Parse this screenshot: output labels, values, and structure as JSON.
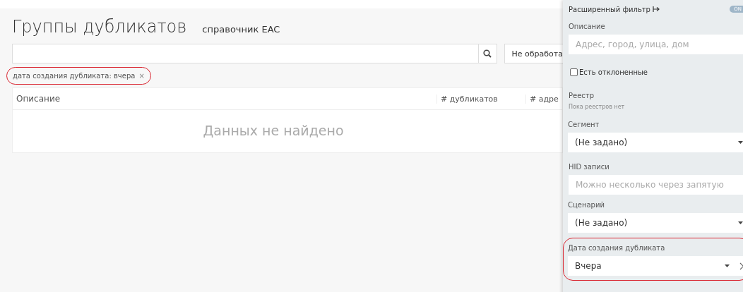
{
  "header": {
    "title": "Группы дубликатов",
    "subtitle": "справочник EAC"
  },
  "status_filter": {
    "value": "Не обработа"
  },
  "active_filters": [
    {
      "label": "дата создания дубликата: вчера",
      "close": "×",
      "highlighted": true
    }
  ],
  "table": {
    "columns": [
      "Описание",
      "# дубликатов",
      "# адре"
    ],
    "empty_message": "Данных не найдено"
  },
  "filter_panel": {
    "title": "Расширенный фильтр",
    "toggle": {
      "label": "ON",
      "on": true
    },
    "fields": [
      {
        "kind": "input",
        "label": "Описание",
        "placeholder": "Адрес, город, улица, дом"
      },
      {
        "kind": "checkbox",
        "label": "Есть отклоненные",
        "checked": false
      },
      {
        "kind": "note",
        "label": "Реестр",
        "note": "Пока реестров нет"
      },
      {
        "kind": "select",
        "label": "Сегмент",
        "value": "(Не задано)",
        "clearable": false
      },
      {
        "kind": "input",
        "label": "HID записи",
        "placeholder": "Можно несколько через запятую"
      },
      {
        "kind": "select",
        "label": "Сценарий",
        "value": "(Не задано)",
        "clearable": false
      },
      {
        "kind": "select",
        "label": "Дата создания дубликата",
        "value": "Вчера",
        "clearable": true,
        "highlighted": true
      }
    ]
  }
}
